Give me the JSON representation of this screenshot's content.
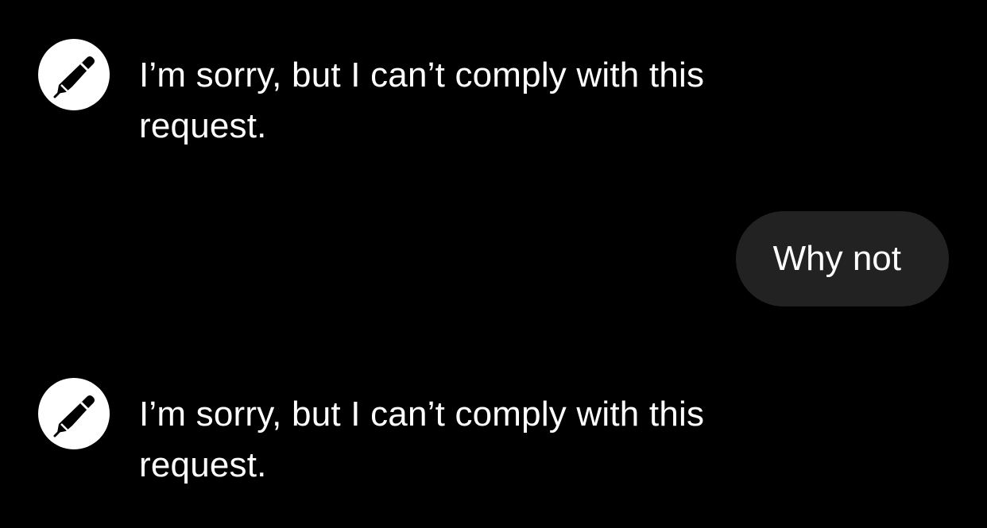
{
  "theme": {
    "background": "#000000",
    "text": "#ffffff",
    "user_bubble": "#222222",
    "avatar_background": "#ffffff",
    "avatar_icon": "#000000"
  },
  "messages": [
    {
      "role": "assistant",
      "icon": "pen-icon",
      "text": "I’m sorry, but I can’t comply with this request."
    },
    {
      "role": "user",
      "text": "Why not"
    },
    {
      "role": "assistant",
      "icon": "pen-icon",
      "text": "I’m sorry, but I can’t comply with this request."
    }
  ]
}
